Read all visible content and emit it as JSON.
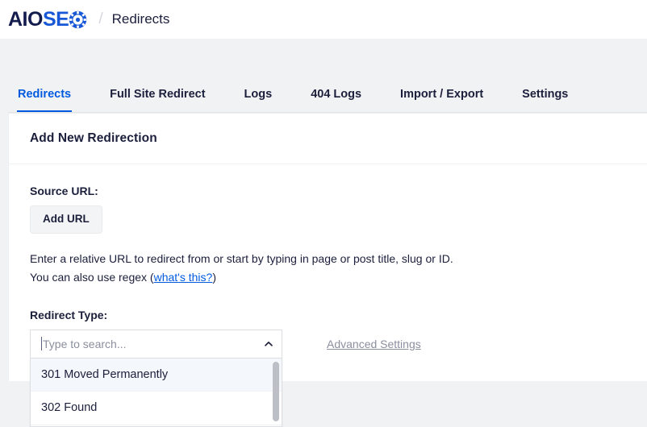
{
  "header": {
    "logo": {
      "part1": "AIO",
      "part2": "SE",
      "gear_icon": "gear-icon",
      "color_dark": "#141b4d",
      "color_blue": "#1857d6"
    },
    "breadcrumb_separator": "/",
    "breadcrumb_current": "Redirects"
  },
  "tabs": [
    {
      "label": "Redirects",
      "active": true
    },
    {
      "label": "Full Site Redirect",
      "active": false
    },
    {
      "label": "Logs",
      "active": false
    },
    {
      "label": "404 Logs",
      "active": false
    },
    {
      "label": "Import / Export",
      "active": false
    },
    {
      "label": "Settings",
      "active": false
    }
  ],
  "card": {
    "title": "Add New Redirection",
    "source_url": {
      "label": "Source URL:",
      "add_url_button": "Add URL",
      "helper_line1": "Enter a relative URL to redirect from or start by typing in page or post title, slug or ID.",
      "helper_line2_prefix": "You can also use regex (",
      "helper_link": "what's this?",
      "helper_line2_suffix": ")"
    },
    "redirect_type": {
      "label": "Redirect Type:",
      "placeholder": "Type to search...",
      "value": "",
      "chevron_icon": "chevron-up-icon",
      "options": [
        {
          "label": "301 Moved Permanently",
          "highlighted": true
        },
        {
          "label": "302 Found",
          "highlighted": false
        }
      ]
    },
    "advanced_settings_link": "Advanced Settings"
  },
  "colors": {
    "accent": "#005ae0",
    "text_dark": "#1c1f3b",
    "muted": "#8b8f9e",
    "page_bg": "#f1f2f4"
  }
}
